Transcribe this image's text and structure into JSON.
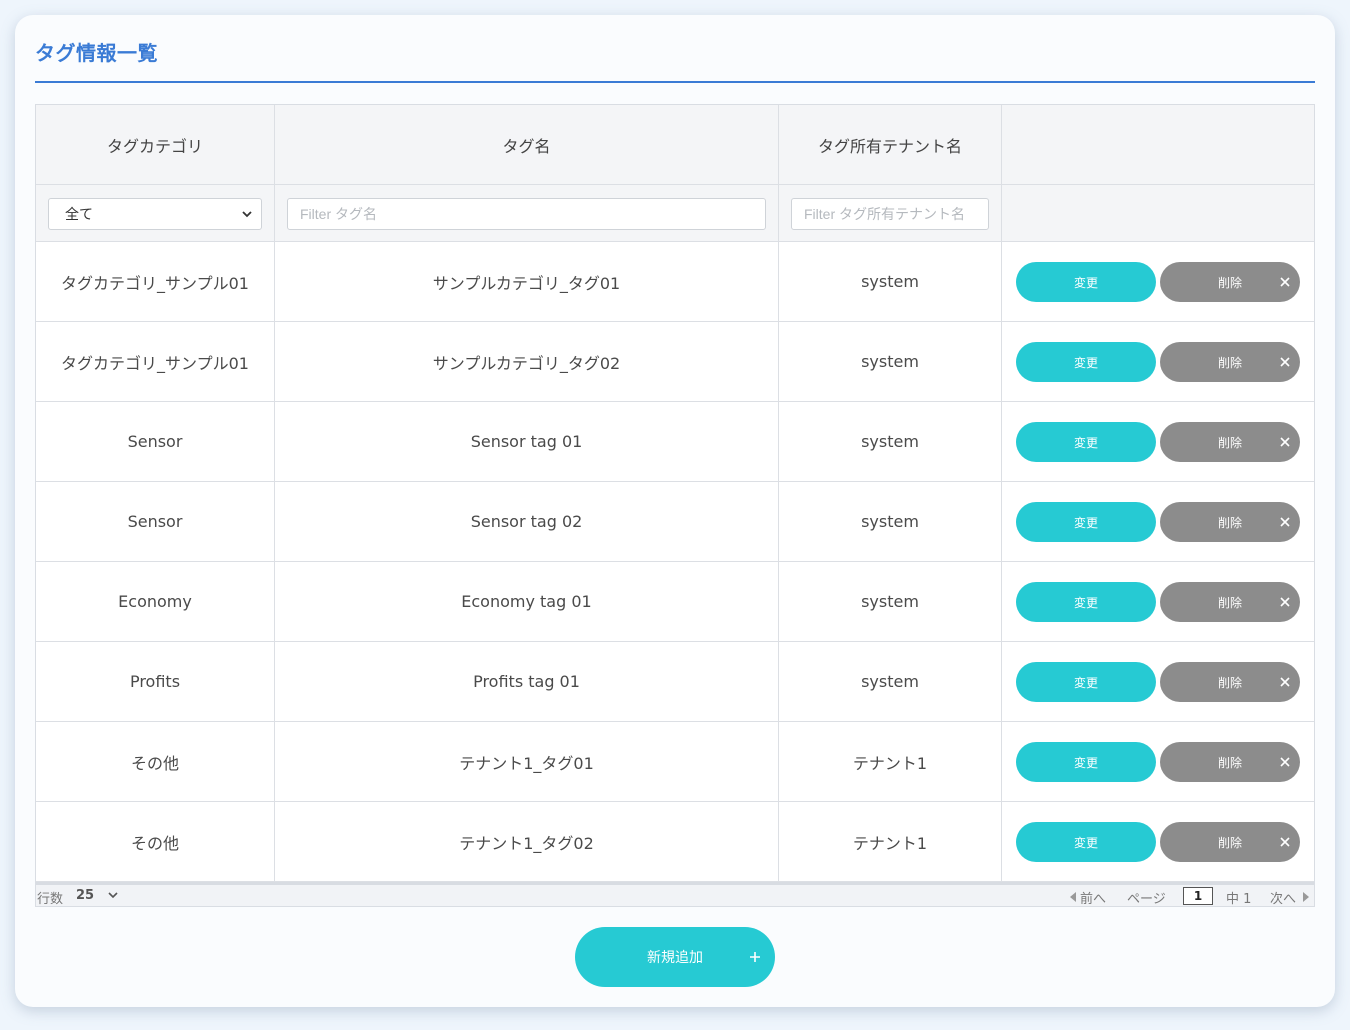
{
  "page": {
    "title": "タグ情報一覧"
  },
  "columns": [
    "タグカテゴリ",
    "タグ名",
    "タグ所有テナント名",
    ""
  ],
  "filters": {
    "category_select": "全て",
    "tag_name_placeholder": "Filter タグ名",
    "tenant_placeholder": "Filter タグ所有テナント名"
  },
  "rows": [
    {
      "category": "タグカテゴリ_サンプル01",
      "tag": "サンプルカテゴリ_タグ01",
      "tenant": "system"
    },
    {
      "category": "タグカテゴリ_サンプル01",
      "tag": "サンプルカテゴリ_タグ02",
      "tenant": "system"
    },
    {
      "category": "Sensor",
      "tag": "Sensor tag 01",
      "tenant": "system"
    },
    {
      "category": "Sensor",
      "tag": "Sensor tag 02",
      "tenant": "system"
    },
    {
      "category": "Economy",
      "tag": "Economy tag 01",
      "tenant": "system"
    },
    {
      "category": "Profits",
      "tag": "Profits tag 01",
      "tenant": "system"
    },
    {
      "category": "その他",
      "tag": "テナント1_タグ01",
      "tenant": "テナント1"
    },
    {
      "category": "その他",
      "tag": "テナント1_タグ02",
      "tenant": "テナント1"
    }
  ],
  "actions": {
    "edit_label": "変更",
    "delete_label": "削除"
  },
  "pager": {
    "rows_label": "行数",
    "rows_value": "25",
    "prev_label": "前へ",
    "page_label": "ページ",
    "current_page": "1",
    "of_label": "中 1",
    "next_label": "次へ"
  },
  "add_button": {
    "label": "新規追加"
  },
  "colors": {
    "accent": "#26cad3",
    "title": "#3a7bd5",
    "delete": "#8c8c8c"
  }
}
